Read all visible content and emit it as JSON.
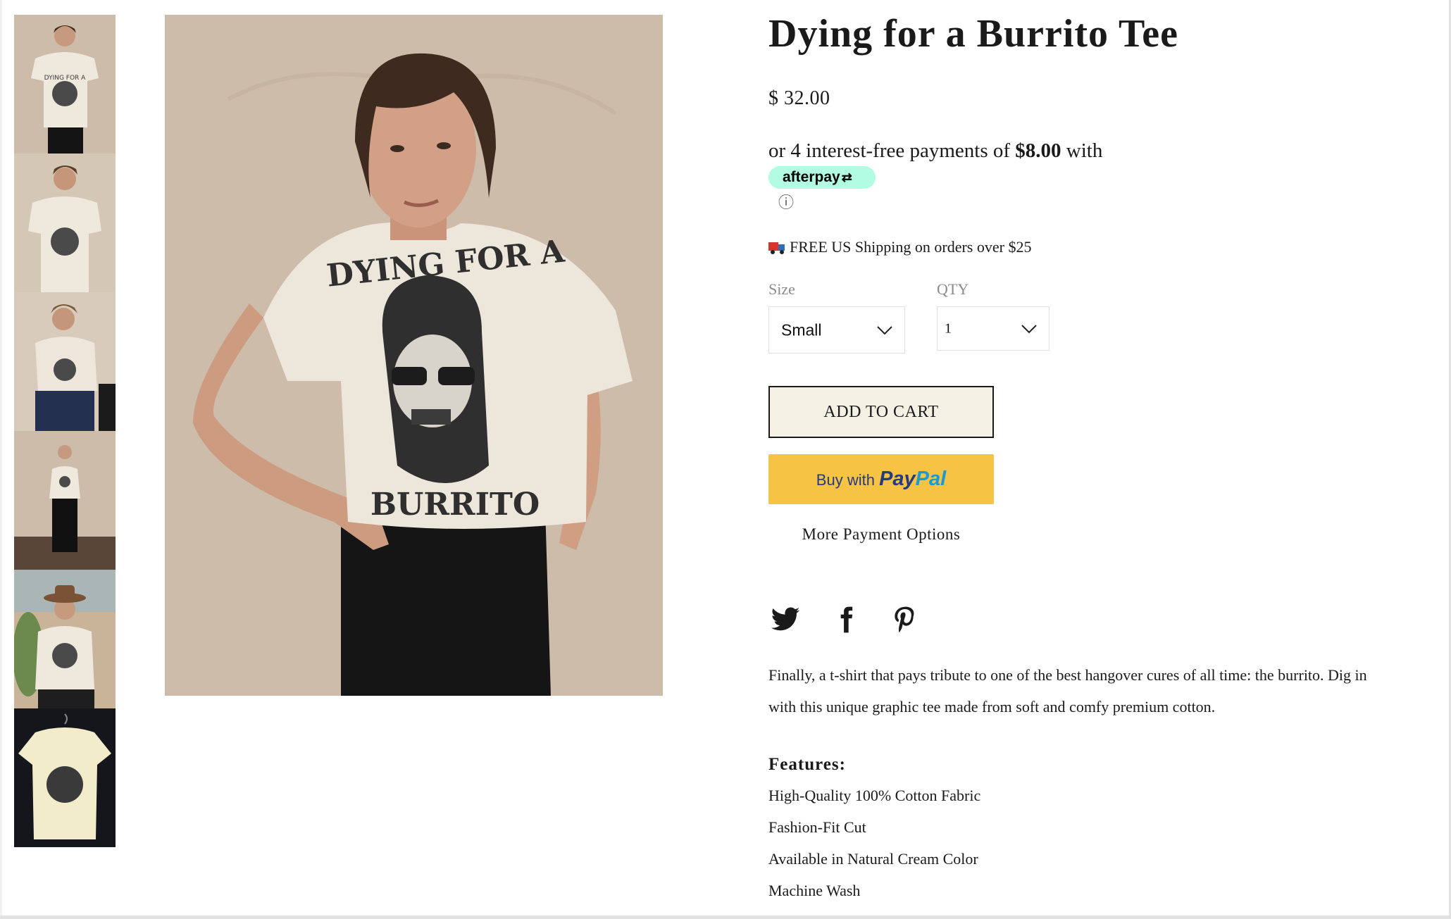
{
  "product": {
    "title": "Dying for a Burrito Tee",
    "price": "$ 32.00",
    "afterpay": {
      "prefix": "or 4 interest-free payments of ",
      "amount": "$8.00",
      "suffix": " with",
      "badge": "afterpay",
      "badge_arrow": "⇄",
      "info_icon": "ⓘ"
    },
    "shipping": "FREE US Shipping on orders over $25",
    "size": {
      "label": "Size",
      "value": "Small"
    },
    "qty": {
      "label": "QTY",
      "value": "1"
    },
    "add_to_cart": "ADD TO CART",
    "paypal": {
      "buy": "Buy with ",
      "brand_pay": "Pay",
      "brand_pal": "Pal"
    },
    "more_payment": "More Payment Options",
    "description": "Finally, a t-shirt that pays tribute to one of the best hangover cures of all time: the burrito. Dig in with this unique graphic tee made from soft and comfy premium cotton.",
    "features_title": "Features:",
    "features": [
      "High-Quality 100% Cotton Fabric",
      "Fashion-Fit Cut",
      "Available in Natural Cream Color",
      "Machine Wash"
    ]
  },
  "images": {
    "tee_print": [
      "DYING FOR A",
      "BURRITO"
    ]
  },
  "social": [
    "twitter-icon",
    "facebook-icon",
    "pinterest-icon"
  ],
  "colors": {
    "afterpay_mint": "#b2fce4",
    "paypal_yellow": "#f7c345",
    "cart_bg": "#f4f0e4",
    "backdrop": "#cbb9a7"
  }
}
